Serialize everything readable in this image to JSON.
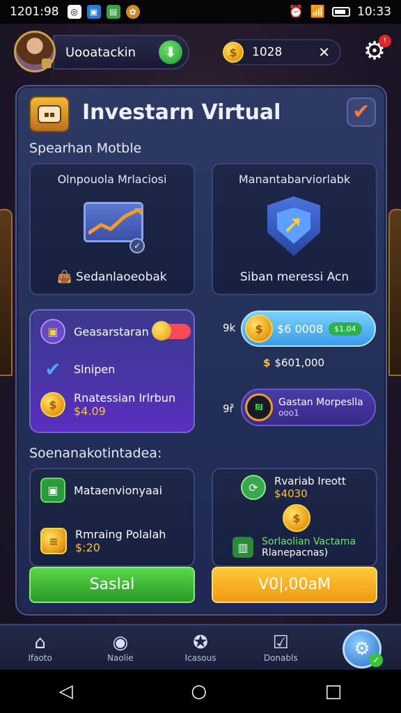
{
  "status_bar": {
    "time_left": "1201:98",
    "time_right": "10:33"
  },
  "header": {
    "username": "Uooatackin",
    "coins": "1028"
  },
  "panel": {
    "title": "Investarn Virtual",
    "section1_label": "Spearhan Motble",
    "card_left": {
      "title": "Olnpouola Mrlaciosi",
      "bottom": "Sedanlaoeobak"
    },
    "card_right": {
      "title": "Manantabarviorlabk",
      "bottom": "Siban meressi Acn"
    },
    "purple_card": {
      "row1": "Geasarstaran",
      "row2": "Slnipen",
      "row3_title": "Rnatessian Irlrbun",
      "row3_amount": "$4.09"
    },
    "right_stats": {
      "label_a": "9k",
      "blue_pill_value": "$6 0008",
      "blue_pill_badge": "$1.04",
      "line_value": "$601,000",
      "label_b": "9ř",
      "purple_pill_title": "Gastan Morpeslla",
      "purple_pill_sub": "ooo1",
      "purple_pill_ring": "₪"
    },
    "section2_label": "Soenanakotintadea:",
    "card_bl": {
      "row1": "Mataenvionyaai",
      "row2_title": "Rmraing Polalah",
      "row2_amount": "$:20",
      "button": "Saslal"
    },
    "card_br": {
      "row1_title": "Rvariab Ireott",
      "row1_amount": "$4030",
      "row2_title": "Sorlaolian Vactama",
      "row2_sub": "Rlanepacnas)",
      "button": "V0|,00aM"
    }
  },
  "bottom_nav": {
    "items": [
      {
        "label": "Ifaoto",
        "icon": "home-icon"
      },
      {
        "label": "Naolie",
        "icon": "news-icon"
      },
      {
        "label": "Icasous",
        "icon": "badge-icon"
      },
      {
        "label": "Donabls",
        "icon": "check-card-icon"
      }
    ]
  },
  "colors": {
    "panel_bg": "#2e3a66",
    "green_button": "#3fb33a",
    "orange_button": "#f7a91f",
    "purple_card": "#4a34a8",
    "accent_blue": "#5bb6ff"
  }
}
